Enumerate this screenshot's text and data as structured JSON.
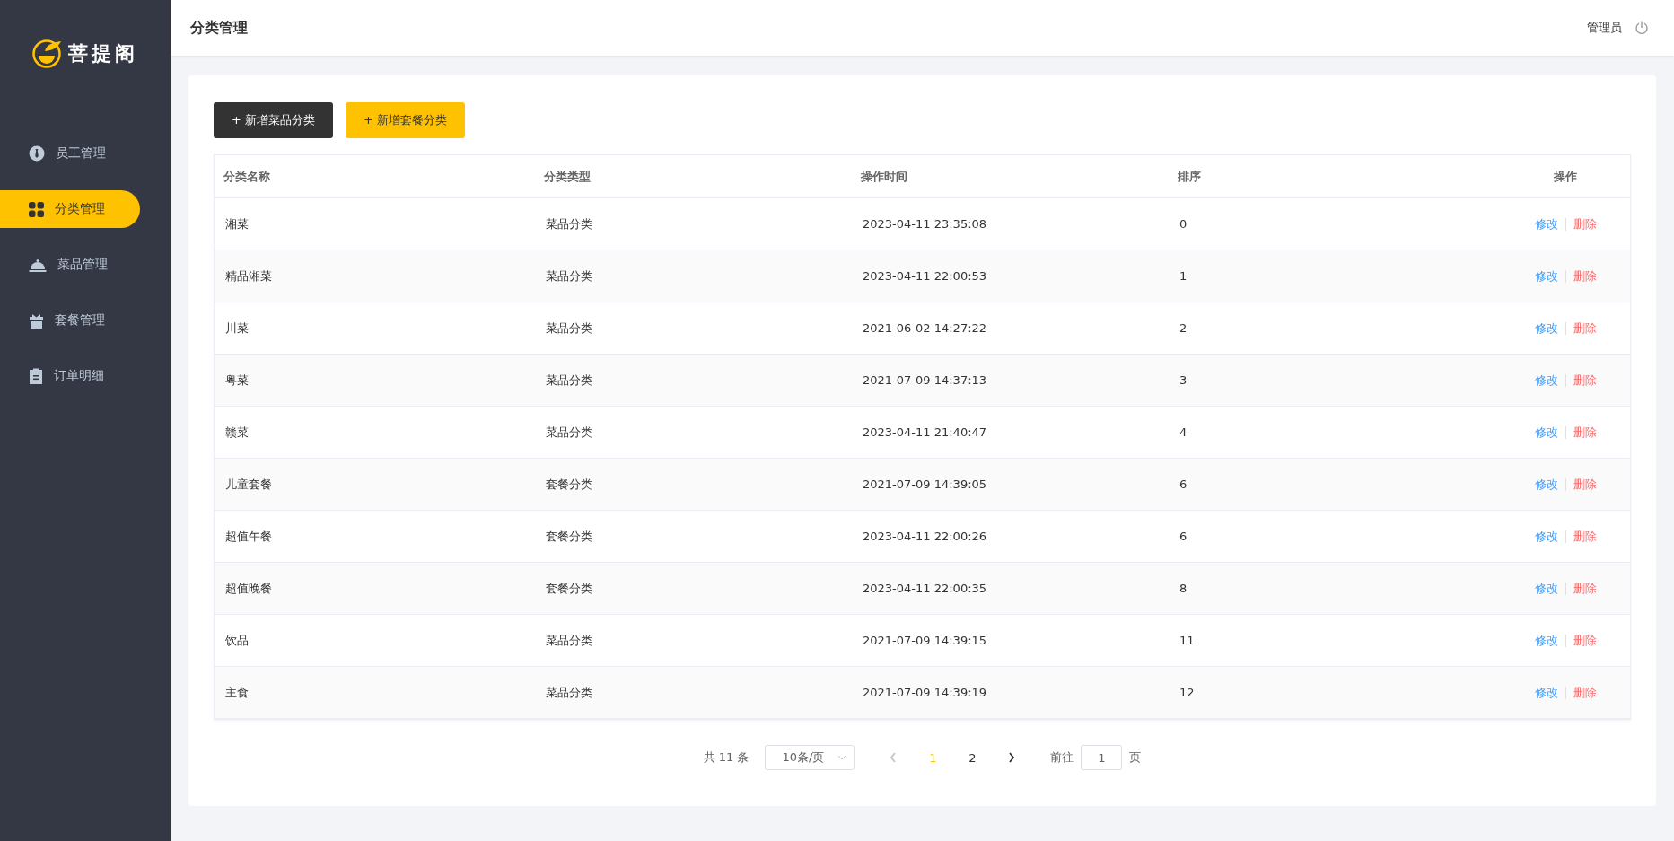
{
  "brand": {
    "name": "菩提阁"
  },
  "sidebar": {
    "items": [
      {
        "label": "员工管理",
        "selected": false
      },
      {
        "label": "分类管理",
        "selected": true
      },
      {
        "label": "菜品管理",
        "selected": false
      },
      {
        "label": "套餐管理",
        "selected": false
      },
      {
        "label": "订单明细",
        "selected": false
      }
    ]
  },
  "header": {
    "title": "分类管理",
    "user": "管理员"
  },
  "actions": [
    {
      "label": "+ 新增菜品分类",
      "kind": "dark"
    },
    {
      "label": "+ 新增套餐分类",
      "kind": "accent"
    }
  ],
  "table": {
    "columns": [
      "分类名称",
      "分类类型",
      "操作时间",
      "排序",
      "操作"
    ],
    "rows": [
      {
        "name": "湘菜",
        "type": "菜品分类",
        "time": "2023-04-11 23:35:08",
        "sort": "0",
        "edit": "修改",
        "delete": "删除"
      },
      {
        "name": "精品湘菜",
        "type": "菜品分类",
        "time": "2023-04-11 22:00:53",
        "sort": "1",
        "edit": "修改",
        "delete": "删除"
      },
      {
        "name": "川菜",
        "type": "菜品分类",
        "time": "2021-06-02 14:27:22",
        "sort": "2",
        "edit": "修改",
        "delete": "删除"
      },
      {
        "name": "粤菜",
        "type": "菜品分类",
        "time": "2021-07-09 14:37:13",
        "sort": "3",
        "edit": "修改",
        "delete": "删除"
      },
      {
        "name": "赣菜",
        "type": "菜品分类",
        "time": "2023-04-11 21:40:47",
        "sort": "4",
        "edit": "修改",
        "delete": "删除"
      },
      {
        "name": "儿童套餐",
        "type": "套餐分类",
        "time": "2021-07-09 14:39:05",
        "sort": "6",
        "edit": "修改",
        "delete": "删除"
      },
      {
        "name": "超值午餐",
        "type": "套餐分类",
        "time": "2023-04-11 22:00:26",
        "sort": "6",
        "edit": "修改",
        "delete": "删除"
      },
      {
        "name": "超值晚餐",
        "type": "套餐分类",
        "time": "2023-04-11 22:00:35",
        "sort": "8",
        "edit": "修改",
        "delete": "删除"
      },
      {
        "name": "饮品",
        "type": "菜品分类",
        "time": "2021-07-09 14:39:15",
        "sort": "11",
        "edit": "修改",
        "delete": "删除"
      },
      {
        "name": "主食",
        "type": "菜品分类",
        "time": "2021-07-09 14:39:19",
        "sort": "12",
        "edit": "修改",
        "delete": "删除"
      }
    ]
  },
  "pagination": {
    "total": "共 11 条",
    "page_size": "10条/页",
    "prev": {
      "disabled": true
    },
    "next": {
      "disabled": false
    },
    "pages": [
      {
        "label": "1",
        "selected": true
      },
      {
        "label": "2",
        "selected": false
      }
    ],
    "goto_label": "前往",
    "goto_value": "1",
    "goto_suffix": "页"
  }
}
